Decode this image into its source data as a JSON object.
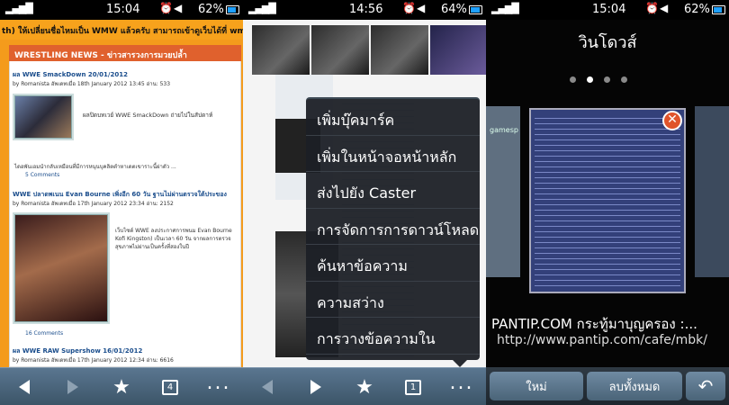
{
  "status_bars": [
    {
      "time": "15:04",
      "battery": "62%"
    },
    {
      "time": "14:56",
      "battery": "64%"
    },
    {
      "time": "15:04",
      "battery": "62%"
    }
  ],
  "pane1": {
    "ticker": "th) ให้เปลี่ยนชื่อไหมเป็น WMW แล้วครับ สามารถเข้าดูเว็บได้ที่ wmwrestling.com หรือ",
    "section_title": "WRESTLING NEWS - ข่าวสารวงการมวยปล้ำ",
    "posts": [
      {
        "title": "ผล WWE SmackDown 20/01/2012",
        "meta": "by Romanista อัพเดทเมื่อ 18th January 2012 13:45 อ่าน: 533",
        "excerpt": "ผลปิดบทเวย์ WWE SmackDown ถ่ายไปในสัปดาห์",
        "body": "ไดอพันเอมนำกลับเหมือนที่มีการหนุนบุคลิตตำหาเดตเขาราะนี้ผ่าตัว ...",
        "comments": "5 Comments"
      },
      {
        "title": "WWE ปลาดพเนน Evan Bourne เพิ่งอีก 60 วัน ฐานไม่ผ่านตรวจใต้ประของ",
        "meta": "by Romanista อัพเดทเมื่อ 17th January 2012 23:34 อ่าน: 2152",
        "excerpt": "เว็บไซต์ WWE ลงประกาศการพนม Evan Bourne Kofi Kingston) เป็นเวลา 60 วัน จากผลการตรวจสุขภาพไม่ผ่านเป็นครั้งที่สองในปี",
        "comments": "16 Comments"
      },
      {
        "title": "ผล WWE RAW Supershow 16/01/2012",
        "meta": "by Romanista อัพเดทเมื่อ 17th January 2012 12:34 อ่าน: 6616"
      }
    ],
    "toolbar": {
      "tab_count": "4"
    }
  },
  "pane2": {
    "menu_items": [
      "เพิ่มบุ๊คมาร์ค",
      "เพิ่มในหน้าจอหน้าหลัก",
      "ส่งไปยัง Caster",
      "การจัดการการดาวน์โหลด",
      "ค้นหาข้อความ",
      "ความสว่าง",
      "การวางข้อความใน"
    ],
    "toolbar": {
      "tab_count": "1"
    }
  },
  "pane3": {
    "title": "วินโดวส์",
    "page_indicator": {
      "count": 4,
      "active": 1
    },
    "window_name": "PANTIP.COM กระทู้มาบุญครอง :...",
    "window_url": "http://www.pantip.com/cafe/mbk/",
    "buttons": {
      "new": "ใหม่",
      "clear_all": "ลบทั้งหมด"
    },
    "side_label": "gamesp"
  },
  "icons": [
    "signal-icon",
    "wifi-icon",
    "alarm-icon",
    "vibrate-icon",
    "battery-icon",
    "back-icon",
    "forward-icon",
    "bookmark-star-icon",
    "tabs-icon",
    "more-icon",
    "close-icon",
    "return-icon"
  ]
}
